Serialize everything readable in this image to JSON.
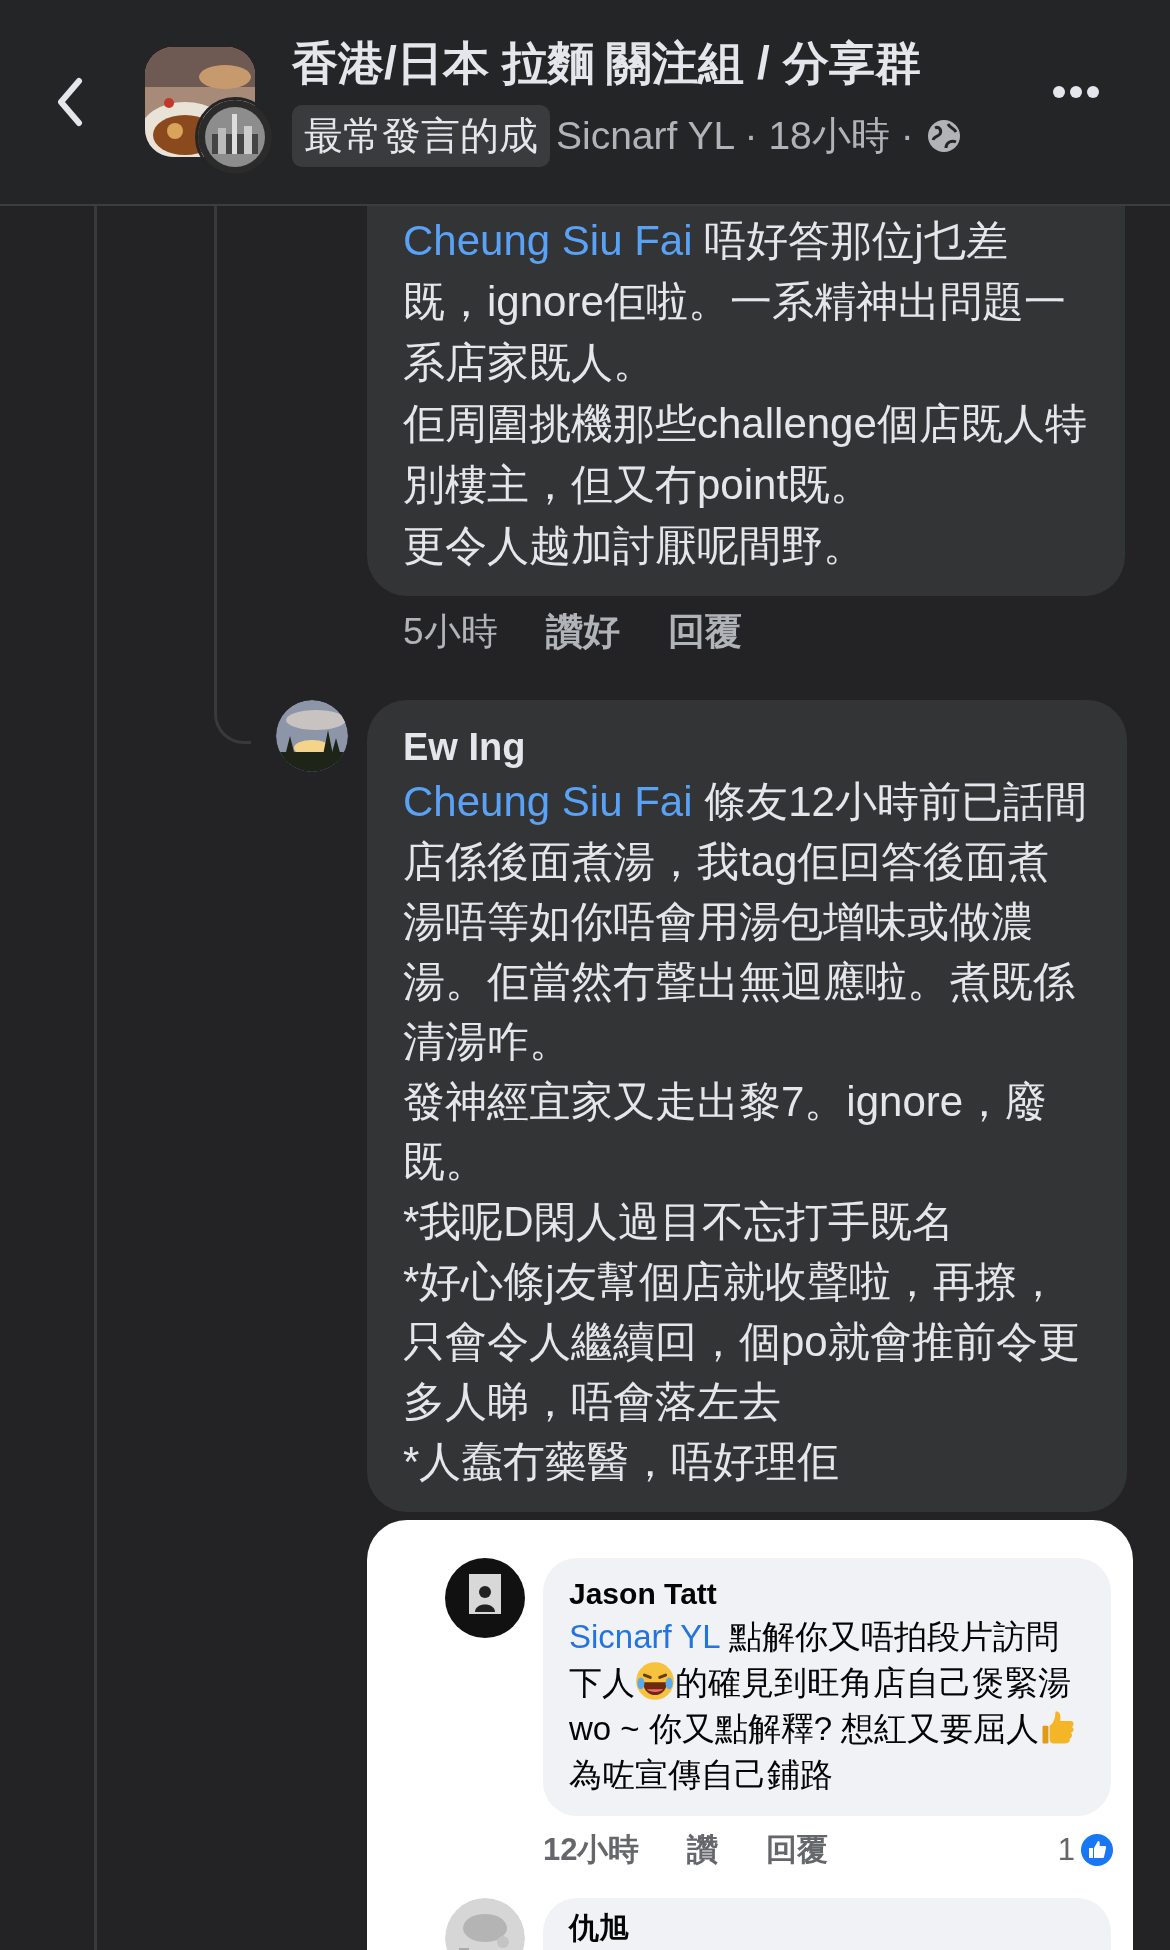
{
  "header": {
    "title": "香港/日本 拉麵 關注組 / 分享群",
    "badge": "最常發言的成",
    "meta": "Sicnarf YL · 18小時 ·"
  },
  "comments": [
    {
      "mention": "Cheung Siu Fai",
      "paragraphs": [
        " 唔好答那位j乜差既，ignore佢啦。一系精神出問題一系店家既人。",
        "佢周圍挑機那些challenge個店既人特別樓主，但又冇point既。",
        "更令人越加討厭呢間野。"
      ],
      "time": "5小時",
      "like": "讚好",
      "reply": "回覆"
    },
    {
      "name": "Ew Ing",
      "mention": "Cheung Siu Fai",
      "paragraphs": [
        " 條友12小時前已話間店係後面煮湯，我tag佢回答後面煮湯唔等如你唔會用湯包增味或做濃湯。佢當然冇聲出無迴應啦。煮既係清湯咋。",
        "發神經宜家又走出黎7。ignore，廢既。",
        "*我呢D閑人過目不忘打手既名",
        "*好心條j友幫個店就收聲啦，再撩，只會令人繼續回，個po就會推前令更多人睇，唔會落左去",
        "*人蠢冇藥醫，唔好理佢"
      ]
    }
  ],
  "embedded": {
    "name": "Jason Tatt",
    "mention": "Sicnarf YL",
    "segments": [
      {
        "kind": "text",
        "text": " 點解你又唔拍段片訪問下人"
      },
      {
        "kind": "laughing"
      },
      {
        "kind": "text",
        "text": "的確見到旺角店自己煲緊湯wo ~ 你又點解釋? 想紅又要屈人"
      },
      {
        "kind": "thumbs"
      },
      {
        "kind": "text",
        "text": "為咗宣傳自己鋪路"
      }
    ],
    "time": "12小時",
    "like": "讚",
    "reply": "回覆",
    "reactions": "1",
    "next_name": "仇旭"
  }
}
